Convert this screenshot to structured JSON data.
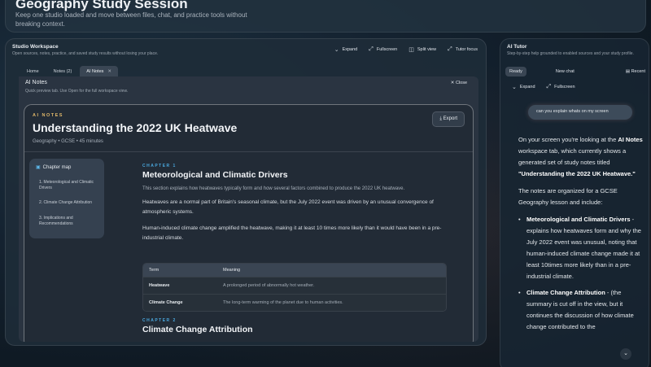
{
  "session": {
    "title": "Geography Study Session",
    "subtitle": "Keep one studio loaded and move between files, chat, and practice tools without breaking context."
  },
  "studio": {
    "title": "Studio Workspace",
    "subtitle": "Open sources, notes, practice, and saved study results without losing your place.",
    "tools": [
      "Expand",
      "Fullscreen",
      "Split view",
      "Tutor focus"
    ],
    "tabs": [
      "Home",
      "Notes (2)",
      "AI Notes"
    ],
    "active_tab_index": 2
  },
  "panel": {
    "title": "AI Notes",
    "subtitle": "Quick preview tab. Use Open for the full workspace view.",
    "close_label": "Close"
  },
  "doc": {
    "kicker": "AI NOTES",
    "title": "Understanding the 2022 UK Heatwave",
    "meta": "Geography • GCSE • 45 minutes",
    "export_label": "Export"
  },
  "chapter_map": {
    "title": "Chapter map",
    "items": [
      "1. Meteorological and Climatic Drivers",
      "2. Climate Change Attribution",
      "3. Implications and Recommendations"
    ]
  },
  "chapter1": {
    "label": "CHAPTER 1",
    "title": "Meteorological and Climatic Drivers",
    "intro": "This section explains how heatwaves typically form and how several factors combined to produce the 2022 UK heatwave.",
    "para1": "Heatwaves are a normal part of Britain's seasonal climate, but the July 2022 event was driven by an unusual convergence of atmospheric systems.",
    "para2": "Human-induced climate change amplified the heatwave, making it at least 10 times more likely than it would have been in a pre-industrial climate."
  },
  "table": {
    "headers": [
      "Term",
      "Meaning"
    ],
    "rows": [
      [
        "Heatwave",
        "A prolonged period of abnormally hot weather."
      ],
      [
        "Climate Change",
        "The long-term warming of the planet due to human activities."
      ]
    ]
  },
  "chapter2": {
    "label": "CHAPTER 2",
    "title": "Climate Change Attribution"
  },
  "tutor": {
    "title": "AI Tutor",
    "subtitle": "Step-by-step help grounded to enabled sources and your study profile.",
    "tabs": [
      "Ready",
      "New chat",
      "Recent"
    ],
    "tools": [
      "Expand",
      "Fullscreen"
    ],
    "user_message": "can you explain whats on my screen",
    "answer": {
      "p1_a": "On your screen you're looking at the ",
      "p1_b": "AI Notes",
      "p1_c": " workspace tab, which currently shows a generated set of study notes titled ",
      "p1_d": "\"Understanding the 2022 UK Heatwave.\"",
      "p2": "The notes are organized for a GCSE Geography lesson and include:",
      "b1_title": "Meteorological and Climatic Drivers",
      "b1_text": " - explains how heatwaves form and why the July 2022 event was unusual, noting that human-induced climate change made it at least 10times more likely than in a pre-industrial climate.",
      "b2_title": "Climate Change Attribution",
      "b2_text": " - (the summary is cut off in the view, but it continues the discussion of how climate change contributed to the"
    }
  }
}
